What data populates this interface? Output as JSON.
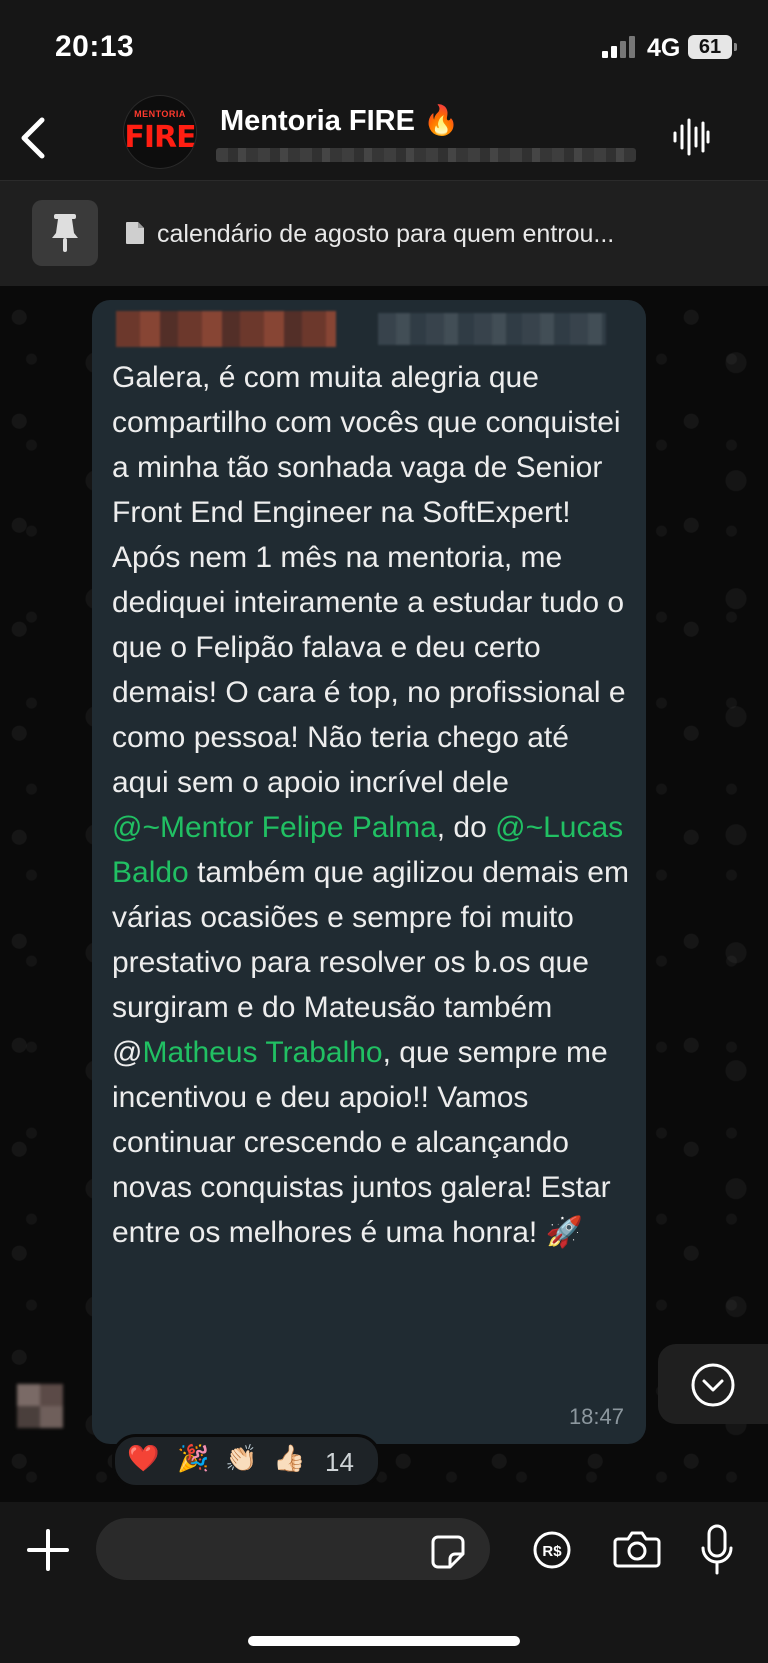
{
  "status_bar": {
    "time": "20:13",
    "network": "4G",
    "battery": "61"
  },
  "header": {
    "title": "Mentoria FIRE 🔥",
    "avatar_small": "MENTORIA",
    "avatar_big": "FIRE"
  },
  "pinned": {
    "text": "calendário de agosto para quem entrou..."
  },
  "message": {
    "segments": [
      {
        "text": "Galera, é com muita alegria que compartilho com vocês que conquistei a minha tão sonhada vaga de Senior Front End Engineer na SoftExpert! Após nem 1 mês na mentoria, me dediquei inteiramente a estudar tudo o que o Felipão falava e deu certo demais! O cara é top, no profissional e como pessoa! Não teria chego até aqui sem o apoio incrível dele "
      },
      {
        "text": "@~Mentor Felipe Palma",
        "mention": true
      },
      {
        "text": ", do "
      },
      {
        "text": "@~Lucas Baldo",
        "mention": true
      },
      {
        "text": " também que agilizou demais em várias ocasiões e sempre foi muito prestativo para resolver os b.os que surgiram e do Mateusão também @"
      },
      {
        "text": "Matheus Trabalho",
        "mention": true
      },
      {
        "text": ", que sempre me incentivou e deu apoio!! Vamos continuar crescendo e alcançando novas conquistas juntos galera! Estar entre os melhores é uma honra! 🚀"
      }
    ],
    "time": "18:47"
  },
  "reactions": {
    "emojis": [
      "❤️",
      "🎉",
      "👏🏻",
      "👍🏻"
    ],
    "count": "14"
  },
  "colors": {
    "mention": "#21c063",
    "bubble": "#202b32",
    "bar": "#161616"
  }
}
